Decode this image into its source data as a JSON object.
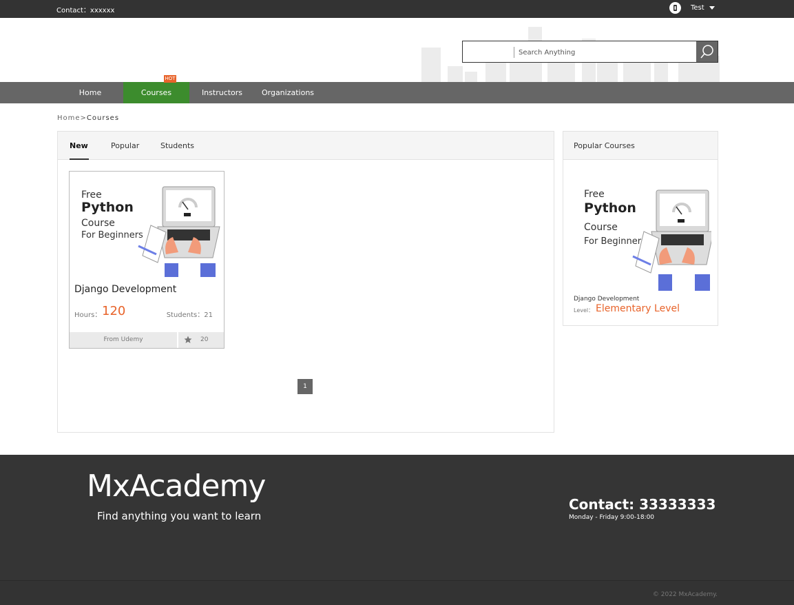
{
  "topbar": {
    "contact": "Contact：xxxxxx",
    "user_name": "Test",
    "user_icon": "user-icon"
  },
  "search": {
    "placeholder": "Search Anything",
    "button_icon": "search-icon"
  },
  "nav": {
    "items": [
      {
        "label": "Home"
      },
      {
        "label": "Courses"
      },
      {
        "label": "Instructors"
      },
      {
        "label": "Organizations"
      }
    ],
    "active_index": 1,
    "hot_badge": "HOT",
    "active_color": "#3c8c2d",
    "hot_color": "#e8632a"
  },
  "breadcrumb": {
    "home": "Home",
    "separator": ">",
    "current": "Courses"
  },
  "tabs": [
    {
      "label": "New",
      "active": true
    },
    {
      "label": "Popular",
      "active": false
    },
    {
      "label": "Students",
      "active": false
    }
  ],
  "course_card": {
    "thumb_line1": "Free",
    "thumb_line2": "Python",
    "thumb_line3": "Course",
    "thumb_line4": "For Beginners",
    "title": "Django Development",
    "hours_label": "Hours：",
    "hours": "120",
    "students": "Students：21",
    "from": "From Udemy",
    "favorites": "20"
  },
  "pagination": {
    "current": "1"
  },
  "popular": {
    "heading": "Popular Courses",
    "thumb_line1": "Free",
    "thumb_line2": "Python",
    "thumb_line3": "Course",
    "thumb_line4": "For Beginners",
    "title": "Django Development",
    "level_label": "Level：",
    "level": "Elementary Level"
  },
  "footer": {
    "brand": "MxAcademy",
    "tagline": "Find anything you want to learn",
    "contact": "Contact: 33333333",
    "hours": "Monday - Friday 9:00-18:00",
    "copyright": "© 2022 MxAcademy."
  },
  "colors": {
    "accent": "#e8632a",
    "topbar": "#333333",
    "nav": "#666666"
  }
}
